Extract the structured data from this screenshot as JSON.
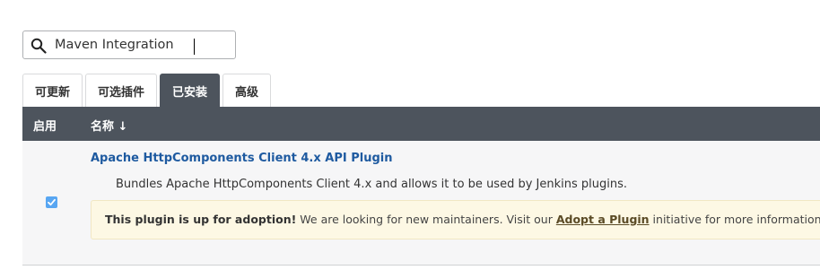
{
  "search": {
    "value": "Maven Integration",
    "icon": "search-icon"
  },
  "tabs": [
    {
      "label": "可更新",
      "active": false
    },
    {
      "label": "可选插件",
      "active": false
    },
    {
      "label": "已安装",
      "active": true
    },
    {
      "label": "高级",
      "active": false
    }
  ],
  "table": {
    "headers": {
      "enabled": "启用",
      "name": "名称 ↓"
    },
    "rows": [
      {
        "enabled": true,
        "name": "Apache HttpComponents Client 4.x API Plugin",
        "description": "Bundles Apache HttpComponents Client 4.x and allows it to be used by Jenkins plugins.",
        "adoption": {
          "strong": "This plugin is up for adoption!",
          "text_before": " We are looking for new maintainers. Visit our ",
          "link": "Adopt a Plugin",
          "text_after": " initiative for more information."
        }
      }
    ]
  },
  "colors": {
    "header_bg": "#4d545d",
    "link": "#1e5aa0",
    "adoption_bg": "#fdf8e4",
    "checkbox": "#58a6f2"
  }
}
